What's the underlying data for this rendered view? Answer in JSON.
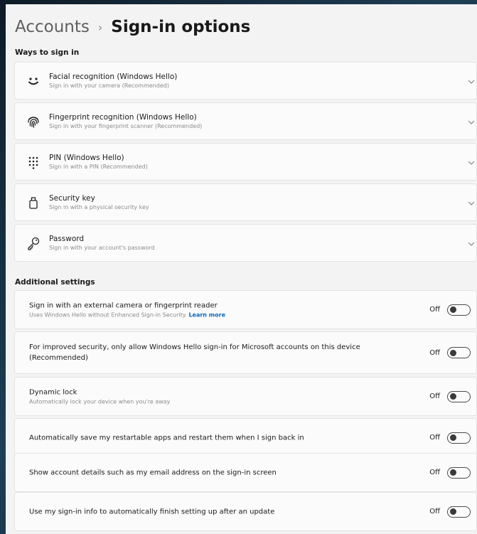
{
  "breadcrumb": {
    "parent": "Accounts",
    "separator": "›",
    "current": "Sign-in options"
  },
  "ways_to_sign_in": {
    "title": "Ways to sign in",
    "items": [
      {
        "icon": "face-icon",
        "title": "Facial recognition (Windows Hello)",
        "subtitle": "Sign in with your camera (Recommended)"
      },
      {
        "icon": "fingerprint-icon",
        "title": "Fingerprint recognition (Windows Hello)",
        "subtitle": "Sign in with your fingerprint scanner (Recommended)"
      },
      {
        "icon": "pin-keypad-icon",
        "title": "PIN (Windows Hello)",
        "subtitle": "Sign in with a PIN (Recommended)"
      },
      {
        "icon": "security-key-icon",
        "title": "Security key",
        "subtitle": "Sign in with a physical security key"
      },
      {
        "icon": "password-key-icon",
        "title": "Password",
        "subtitle": "Sign in with your account's password"
      }
    ]
  },
  "additional_settings": {
    "title": "Additional settings",
    "items": [
      {
        "title": "Sign in with an external camera or fingerprint reader",
        "subtitle": "Uses Windows Hello without Enhanced Sign-in Security.",
        "link": "Learn more",
        "state": "Off",
        "on": false
      },
      {
        "title": "For improved security, only allow Windows Hello sign-in for Microsoft accounts on this device (Recommended)",
        "state": "Off",
        "on": false
      },
      {
        "title": "Dynamic lock",
        "subtitle": "Automatically lock your device when you're away",
        "state": "Off",
        "on": false
      },
      {
        "title": "Automatically save my restartable apps and restart them when I sign back in",
        "state": "Off",
        "on": false
      },
      {
        "title": "Show account details such as my email address on the sign-in screen",
        "state": "Off",
        "on": false
      },
      {
        "title": "Use my sign-in info to automatically finish setting up after an update",
        "state": "Off",
        "on": false
      }
    ]
  },
  "colors": {
    "accent_link": "#0067c0",
    "page_background": "#f3f3f3",
    "card_background": "#fbfbfb"
  }
}
